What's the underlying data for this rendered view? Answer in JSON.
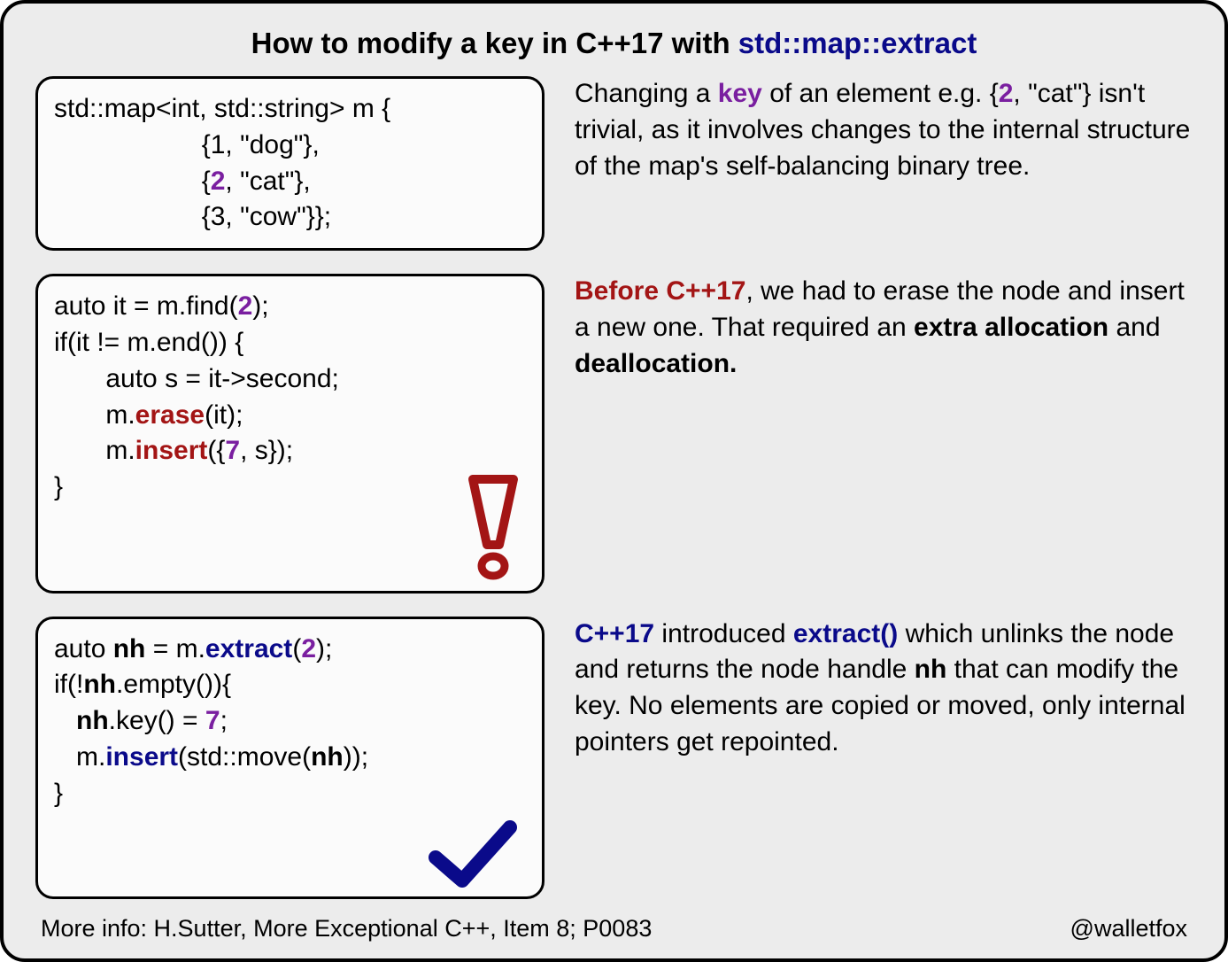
{
  "title": {
    "pre": "How to modify a key in C++17 with ",
    "hl": "std::map::extract"
  },
  "row1": {
    "code": {
      "l1a": "std::map<int, std::string> m {",
      "l2a": "                    {1, \"dog\"},",
      "l3a": "                    {",
      "l3key": "2",
      "l3b": ", \"cat\"},",
      "l4a": "                    {3, \"cow\"}};"
    },
    "text": {
      "t1": "Changing a ",
      "t1k": "key",
      "t2": " of an element e.g. {",
      "t2k": "2",
      "t3": ", \"cat\"} isn't trivial, as it involves changes to the internal structure of the map's self-balancing binary tree."
    }
  },
  "row2": {
    "code": {
      "l1a": "auto it = m.find(",
      "l1k": "2",
      "l1b": ");",
      "l2": "if(it != m.end()) {",
      "l3": "       auto s = it->second;",
      "l4a": "       m.",
      "l4e": "erase",
      "l4b": "(it);",
      "l5a": "       m.",
      "l5i": "insert",
      "l5b": "({",
      "l5k": "7",
      "l5c": ", s});",
      "l6": "}"
    },
    "text": {
      "t1b": "Before C++17",
      "t1": ", we had to erase the node and insert a new one. That required an ",
      "t2b": "extra allocation",
      "t3": " and ",
      "t3b": "deallocation."
    }
  },
  "row3": {
    "code": {
      "l1a": "auto ",
      "l1nh": "nh",
      "l1b": " = m.",
      "l1ex": "extract",
      "l1c": "(",
      "l1k": "2",
      "l1d": ");",
      "l2a": "if(!",
      "l2nh": "nh",
      "l2b": ".empty()){",
      "l3a": "   ",
      "l3nh": "nh",
      "l3b": ".key() = ",
      "l3k": "7",
      "l3c": ";",
      "l4a": "   m.",
      "l4i": "insert",
      "l4b": "(std::move(",
      "l4nh": "nh",
      "l4c": "));",
      "l5": "}"
    },
    "text": {
      "t1b": "C++17",
      "t1": " introduced ",
      "t1ex": "extract()",
      "t2": " which unlinks the node and returns the node handle ",
      "t2nh": "nh",
      "t3": " that can modify the key. No elements are copied or moved, only internal pointers get repointed."
    }
  },
  "footer": {
    "left": "More info: H.Sutter, More Exceptional C++, Item 8; P0083",
    "right": "@walletfox"
  }
}
